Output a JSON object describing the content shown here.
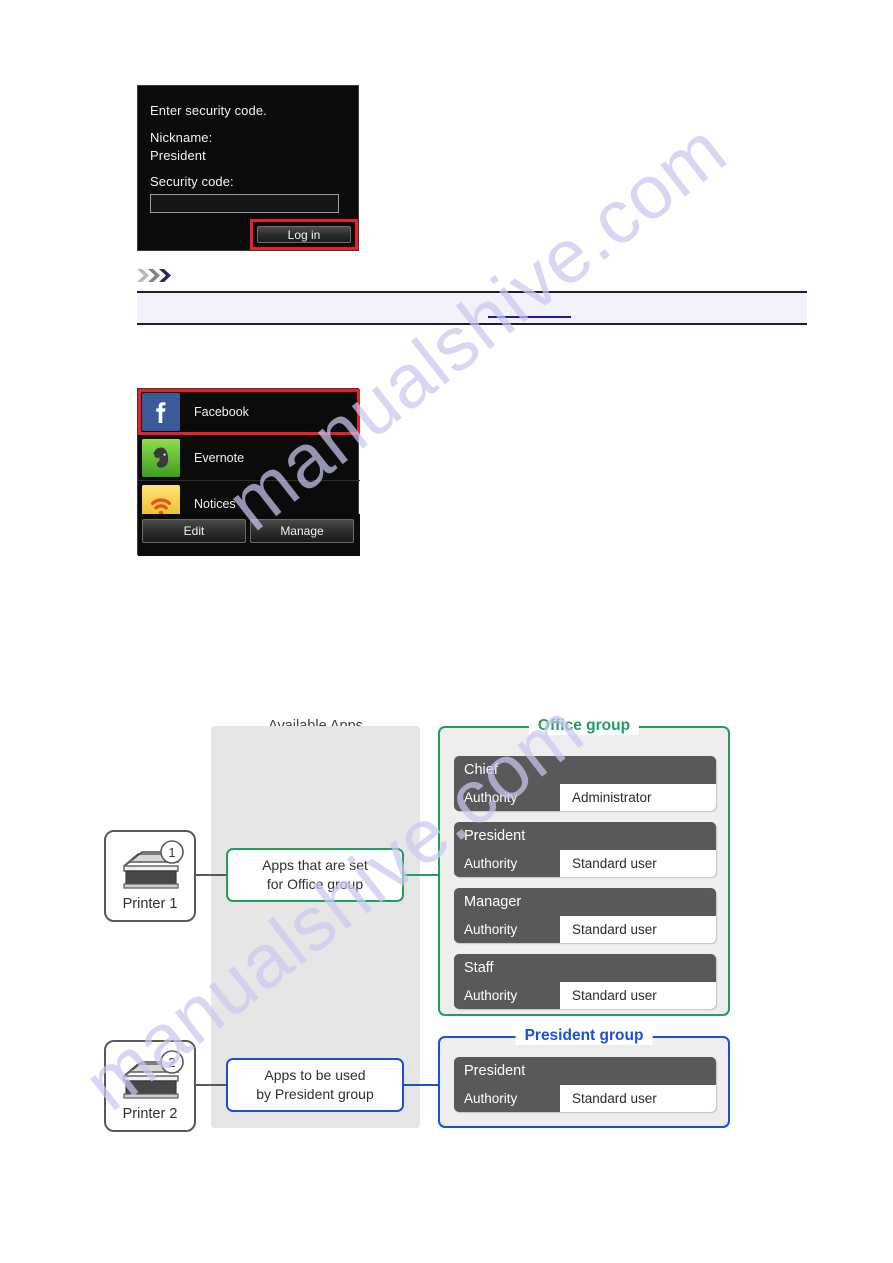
{
  "watermark": {
    "text": "manualshive.com"
  },
  "security_screen": {
    "title": "Enter security code.",
    "nickname_label": "Nickname:",
    "nickname_value": "President",
    "security_code_label": "Security code:",
    "security_code_value": "",
    "security_code_placeholder": "",
    "login_button": "Log in"
  },
  "note": {
    "chevron_icon": "triple-chevron-icon",
    "body_text": "",
    "link_text": ""
  },
  "apps_screen": {
    "items": [
      {
        "label": "Facebook",
        "icon": "facebook-icon",
        "selected": true
      },
      {
        "label": "Evernote",
        "icon": "evernote-icon",
        "selected": false
      },
      {
        "label": "Notices",
        "icon": "notices-wifi-icon",
        "selected": false
      }
    ],
    "edit_button": "Edit",
    "manage_button": "Manage"
  },
  "diagram": {
    "available_apps_title": "Available Apps",
    "printers": [
      {
        "label": "Printer 1",
        "badge": "1",
        "icon": "printer-icon"
      },
      {
        "label": "Printer 2",
        "badge": "2",
        "icon": "printer-icon"
      }
    ],
    "callouts": [
      {
        "line1": "Apps that are set",
        "line2": "for Office group",
        "color": "#1f9e5f"
      },
      {
        "line1": "Apps to be used",
        "line2": "by President group",
        "color": "#1b4ee0"
      }
    ],
    "groups": [
      {
        "title": "Office group",
        "color": "#1f9e5f",
        "authority_label": "Authority",
        "users": [
          {
            "name": "Chief",
            "authority": "Administrator"
          },
          {
            "name": "President",
            "authority": "Standard user"
          },
          {
            "name": "Manager",
            "authority": "Standard user"
          },
          {
            "name": "Staff",
            "authority": "Standard user"
          }
        ]
      },
      {
        "title": "President group",
        "color": "#1b4ee0",
        "authority_label": "Authority",
        "users": [
          {
            "name": "President",
            "authority": "Standard user"
          }
        ]
      }
    ]
  }
}
